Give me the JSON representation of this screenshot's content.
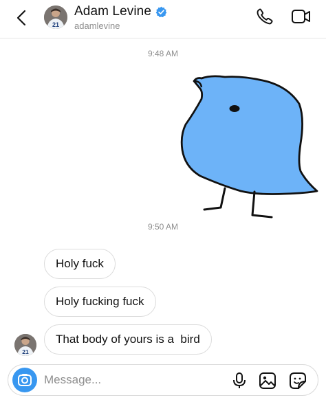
{
  "header": {
    "name": "Adam Levine",
    "username": "adamlevine",
    "verified": true,
    "jersey_number": "21"
  },
  "timestamps": [
    "9:48 AM",
    "9:50 AM"
  ],
  "messages": [
    {
      "text": "Holy fuck"
    },
    {
      "text": "Holy fucking fuck"
    },
    {
      "text": "That body of yours is a  bird"
    }
  ],
  "composer": {
    "placeholder": "Message..."
  },
  "icons": {
    "back": "chevron-left-icon",
    "call": "phone-icon",
    "video": "video-camera-icon",
    "camera": "camera-icon",
    "mic": "microphone-icon",
    "gallery": "image-icon",
    "sticker": "sticker-icon"
  },
  "colors": {
    "accent": "#3897f0",
    "bird_fill": "#6db3f8",
    "verified": "#3897f0",
    "muted_text": "#8e8e8e",
    "bubble_border": "#dbdbdb"
  }
}
